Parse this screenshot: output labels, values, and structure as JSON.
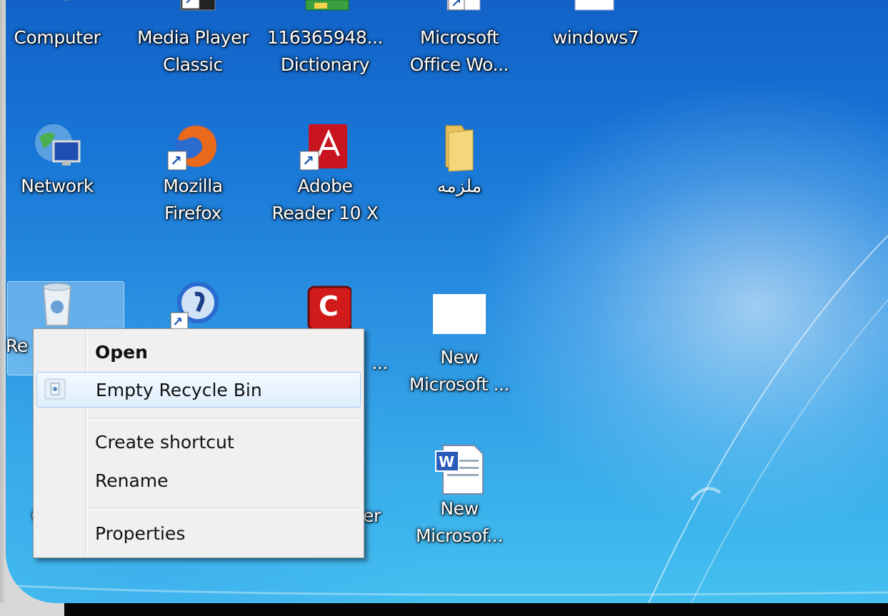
{
  "desktop": {
    "icons": [
      {
        "name": "computer",
        "lines": [
          "Computer"
        ]
      },
      {
        "name": "media-player-classic",
        "lines": [
          "Media Player",
          "Classic"
        ]
      },
      {
        "name": "dictionary",
        "lines": [
          "116365948...",
          "Dictionary"
        ]
      },
      {
        "name": "microsoft-office-word",
        "lines": [
          "Microsoft",
          "Office Wo..."
        ]
      },
      {
        "name": "windows7",
        "lines": [
          "windows7"
        ]
      },
      {
        "name": "network",
        "lines": [
          "Network"
        ]
      },
      {
        "name": "mozilla-firefox",
        "lines": [
          "Mozilla",
          "Firefox"
        ]
      },
      {
        "name": "adobe-reader",
        "lines": [
          "Adobe",
          "Reader 10 X"
        ]
      },
      {
        "name": "folder-arabic",
        "lines": [
          "ملزمه"
        ]
      },
      {
        "name": "recycle-bin",
        "lines": [
          "Re"
        ]
      },
      {
        "name": "app-shortcut-c",
        "lines": [
          "..."
        ]
      },
      {
        "name": "new-microsoft-1",
        "lines": [
          "New",
          "Microsoft ..."
        ]
      },
      {
        "name": "partial-bottom-left",
        "lines": [
          "C"
        ]
      },
      {
        "name": "partial-bottom-mid",
        "lines": [
          "er"
        ]
      },
      {
        "name": "new-microsoft-2",
        "lines": [
          "New",
          "Microsof..."
        ]
      }
    ]
  },
  "context_menu": {
    "items": [
      {
        "label": "Open",
        "bold": true
      },
      {
        "label": "Empty Recycle Bin",
        "icon": "recycle-bin-icon",
        "highlighted": true
      },
      {
        "label": "Create shortcut"
      },
      {
        "label": "Rename"
      },
      {
        "label": "Properties"
      }
    ]
  },
  "colors": {
    "desktop_top": "#1262c8",
    "desktop_bottom": "#45c0f0",
    "menu_bg": "#f0f0f0",
    "menu_highlight_border": "#a8cdf3"
  }
}
